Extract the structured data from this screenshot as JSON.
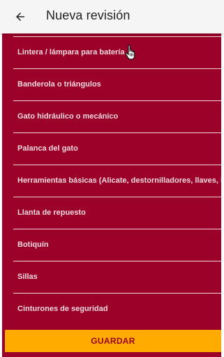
{
  "header": {
    "title": "Nueva revisión",
    "back_icon": "arrow-back-icon"
  },
  "checklist": {
    "items": [
      "Lintera / lámpara para batería",
      "Banderola o triángulos",
      "Gato hidráulico o mecánico",
      "Palanca del gato",
      "Herramientas básicas (Alicate, destornilladores, llaves, bo",
      "Llanta de repuesto",
      "Botiquín",
      "Sillas",
      "Cinturones de seguridad"
    ]
  },
  "footer": {
    "save_label": "GUARDAR"
  },
  "colors": {
    "panel": "#9b0129",
    "accent": "#ffab00",
    "appbar": "#f5f5f5"
  }
}
